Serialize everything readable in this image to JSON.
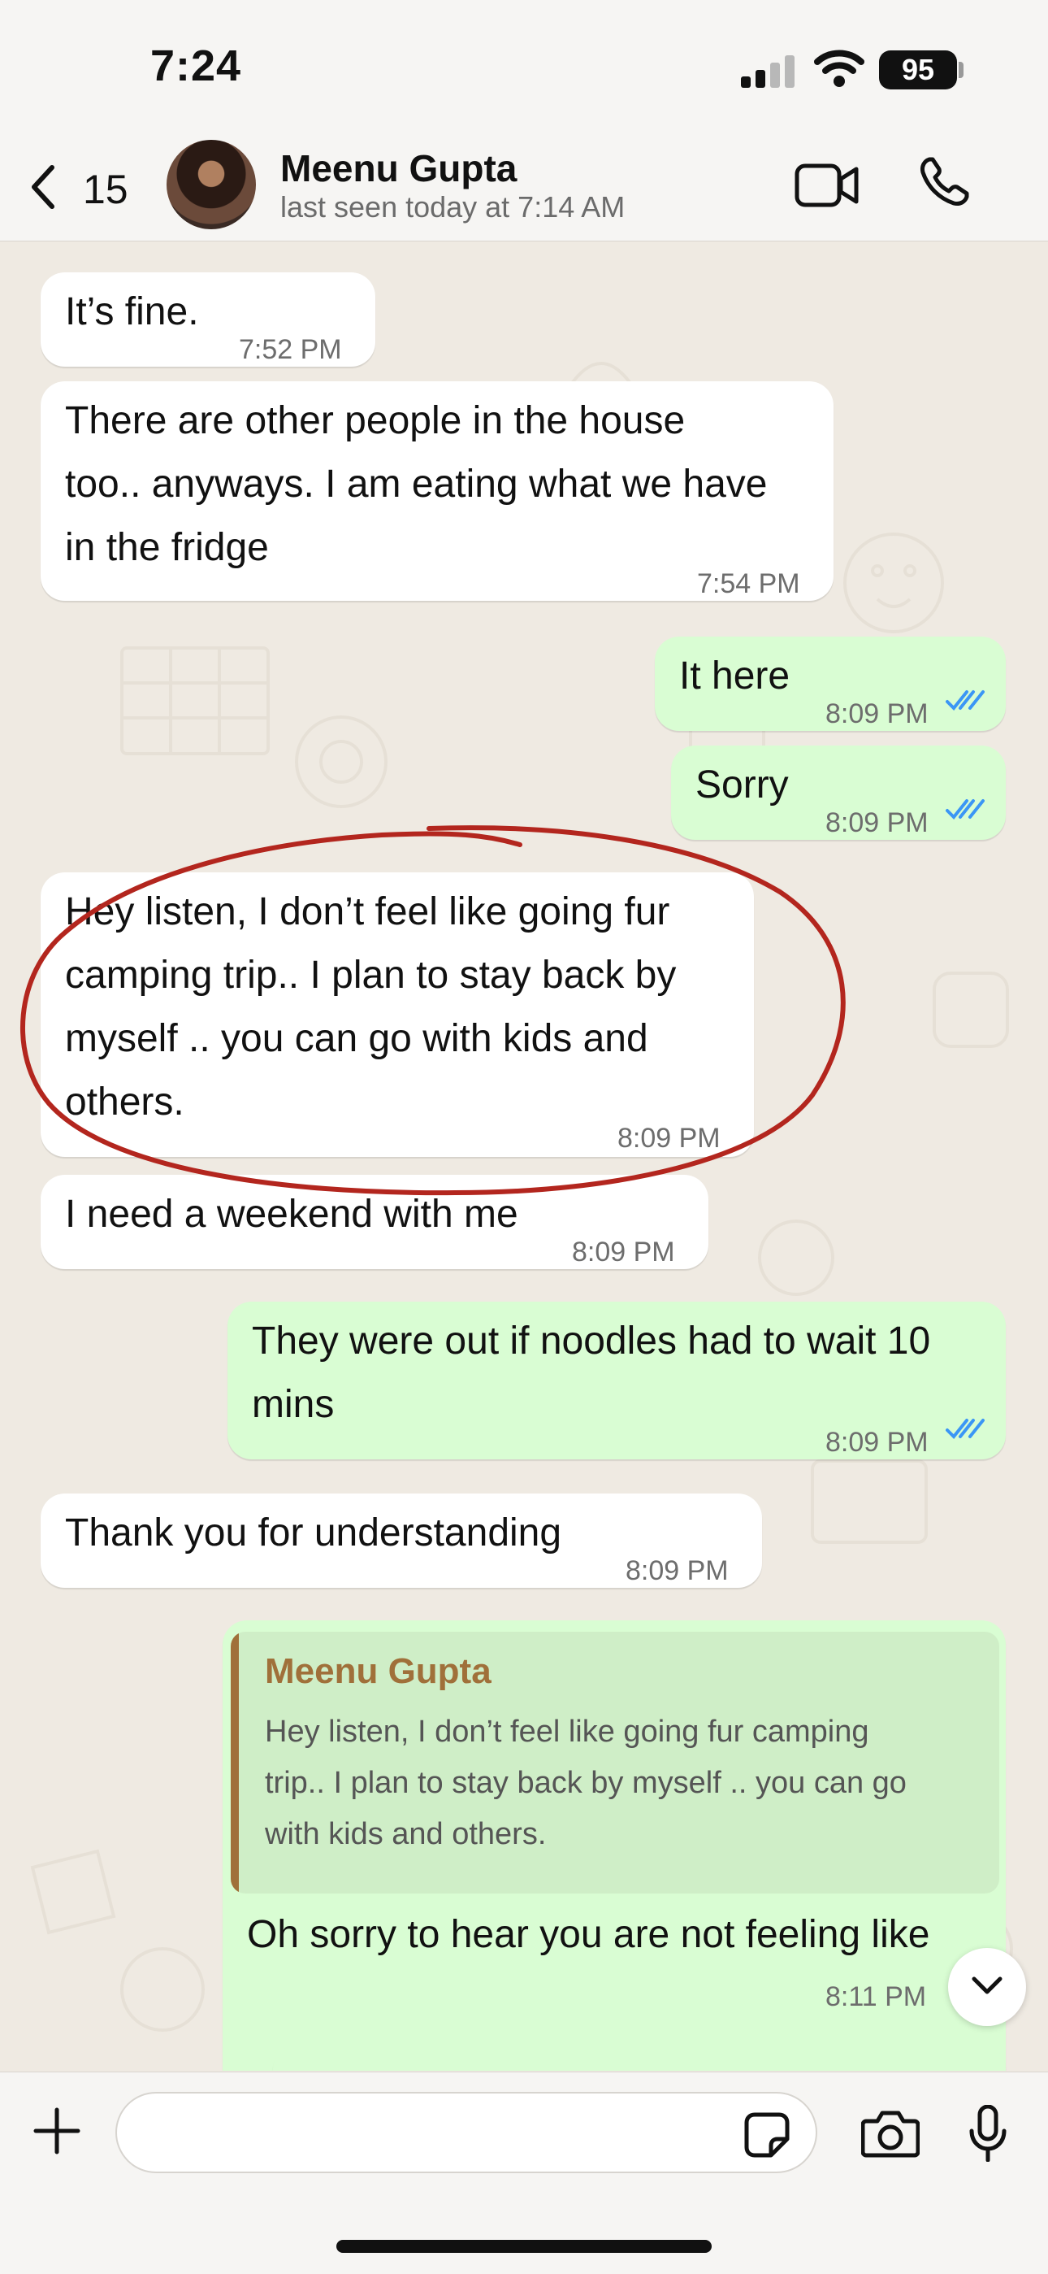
{
  "status_bar": {
    "time": "7:24",
    "battery": "95"
  },
  "header": {
    "unread_count": "15",
    "contact_name": "Meenu Gupta",
    "last_seen": "last seen today at 7:14 AM"
  },
  "messages": [
    {
      "direction": "in",
      "text": "It’s fine.",
      "time": "7:52 PM"
    },
    {
      "direction": "in",
      "lines": [
        "There are other people in the house",
        "too.. anyways. I am eating what we have",
        "in the fridge"
      ],
      "time": "7:54 PM"
    },
    {
      "direction": "out",
      "text": "It here",
      "time": "8:09 PM",
      "status": "read"
    },
    {
      "direction": "out",
      "text": "Sorry",
      "time": "8:09 PM",
      "status": "read"
    },
    {
      "direction": "in",
      "lines": [
        "Hey listen, I don’t feel like going fur",
        "camping trip.. I plan to stay back by",
        "myself .. you can go with kids and",
        "others."
      ],
      "time": "8:09 PM",
      "highlighted": true
    },
    {
      "direction": "in",
      "text": "I need a weekend with me",
      "time": "8:09 PM"
    },
    {
      "direction": "out",
      "lines": [
        "They were out if noodles had to wait 10",
        "mins"
      ],
      "time": "8:09 PM",
      "status": "read"
    },
    {
      "direction": "in",
      "text": "Thank you for understanding",
      "time": "8:09 PM"
    },
    {
      "direction": "out",
      "reply_to": {
        "author": "Meenu Gupta",
        "lines": [
          "Hey listen, I don’t feel like going fur camping",
          "trip.. I plan to stay back by myself .. you can go",
          "with kids and others."
        ]
      },
      "text": "Oh sorry to hear you are not feeling like",
      "time": "8:11 PM",
      "status": "read"
    }
  ],
  "composer": {
    "placeholder": ""
  },
  "colors": {
    "incoming_bubble": "#ffffff",
    "outgoing_bubble": "#d9fdd3",
    "read_tick": "#3b96f5",
    "annotation_circle": "#b3261e",
    "quote_accent": "#a0703a",
    "wallpaper": "#efeae2"
  },
  "icons": [
    "back-chevron-icon",
    "video-camera-icon",
    "phone-icon",
    "plus-icon",
    "sticker-icon",
    "camera-icon",
    "microphone-icon",
    "chevron-down-icon",
    "double-check-icon",
    "signal-icon",
    "wifi-icon",
    "battery-icon"
  ]
}
